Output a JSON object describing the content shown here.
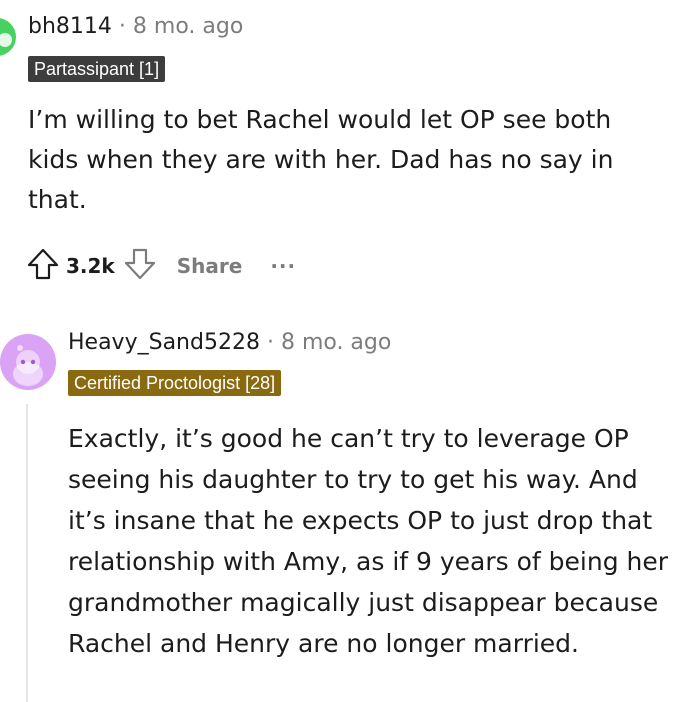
{
  "comment1": {
    "username": "bh8114",
    "separator": "·",
    "age": "8 mo. ago",
    "flair": "Partassipant [1]",
    "body": "I’m willing to bet Rachel would let OP see both kids when they are with her. Dad has no say in that.",
    "score": "3.2k",
    "share_label": "Share",
    "more_label": "···"
  },
  "comment2": {
    "username": "Heavy_Sand5228",
    "separator": "·",
    "age": "8 mo. ago",
    "flair": "Certified Proctologist [28]",
    "body": "Exactly, it’s good he can’t try to leverage OP seeing his daughter to try to get his way. And it’s insane that he expects OP to just drop that relationship with Amy, as if 9 years of being her grandmother magically just disappear because Rachel and Henry are no longer married."
  },
  "colors": {
    "flair1_bg": "#3d3d3d",
    "flair2_bg": "#8a6a10",
    "avatar1_bg": "#46d160",
    "avatar2_bg": "#dba3f5",
    "meta_text": "#7c7c7c"
  }
}
